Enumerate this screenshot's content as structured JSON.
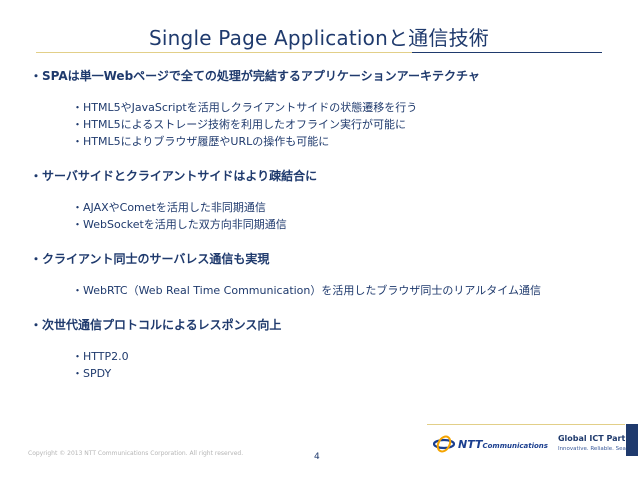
{
  "slide": {
    "title": "Single Page Applicationと通信技術",
    "sections": [
      {
        "heading": "・SPAは単一Webページで全ての処理が完結するアプリケーションアーキテクチャ",
        "items": [
          "・HTML5やJavaScriptを活用しクライアントサイドの状態遷移を行う",
          "・HTML5によるストレージ技術を利用したオフライン実行が可能に",
          "・HTML5によりブラウザ履歴やURLの操作も可能に"
        ]
      },
      {
        "heading": "・サーバサイドとクライアントサイドはより疎結合に",
        "items": [
          "・AJAXやCometを活用した非同期通信",
          "・WebSocketを活用した双方向非同期通信"
        ]
      },
      {
        "heading": "・クライアント同士のサーバレス通信も実現",
        "items": [
          "・WebRTC（Web Real Time Communication）を活用したブラウザ同士のリアルタイム通信"
        ]
      },
      {
        "heading": "・次世代通信プロトコルによるレスポンス向上",
        "items": [
          "・HTTP2.0",
          "・SPDY"
        ]
      }
    ]
  },
  "footer": {
    "copyright": "Copyright © 2013 NTT Communications Corporation. All right reserved.",
    "page_number": "4",
    "logo_text": "NTT",
    "logo_text_small": "Communications",
    "partner_title": "Global ICT Partner",
    "partner_subtitle": "Innovative. Reliable. Seamless."
  },
  "colors": {
    "title": "#1f3a6d",
    "rule_gold": "#e2cf88",
    "rule_navy": "#1f3a6d",
    "text": "#1f3a6d",
    "logo_blue": "#1b3f8f",
    "logo_accent": "#f5a400"
  }
}
